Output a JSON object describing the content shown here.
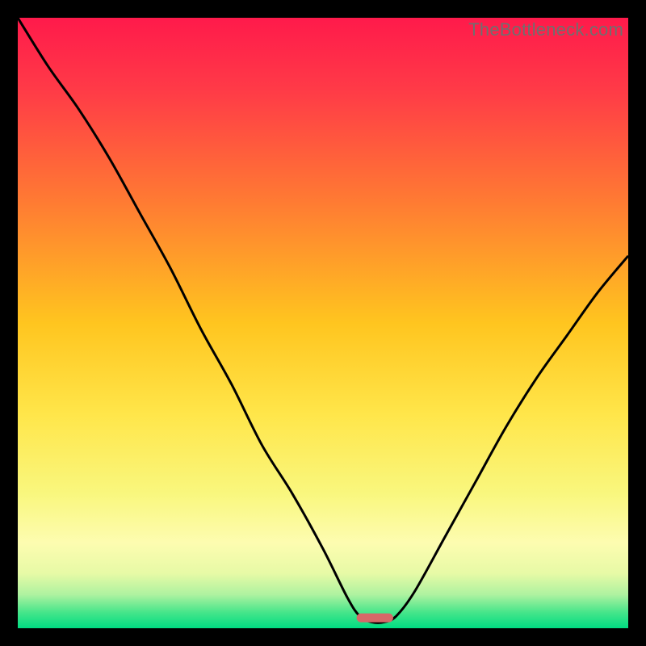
{
  "watermark": "TheBottleneck.com",
  "chart_data": {
    "type": "line",
    "title": "",
    "xlabel": "",
    "ylabel": "",
    "xlim": [
      0,
      100
    ],
    "ylim": [
      0,
      100
    ],
    "x": [
      0,
      5,
      10,
      15,
      20,
      25,
      30,
      35,
      40,
      45,
      50,
      54,
      56,
      58,
      60,
      62,
      65,
      70,
      75,
      80,
      85,
      90,
      95,
      100
    ],
    "values": [
      100,
      92,
      85,
      77,
      68,
      59,
      49,
      40,
      30,
      22,
      13,
      5,
      2,
      1,
      1,
      2,
      6,
      15,
      24,
      33,
      41,
      48,
      55,
      61
    ],
    "marker": {
      "x_start": 55.5,
      "x_end": 61.5,
      "y": 1.7,
      "color": "#d66868"
    },
    "gradient_stops": [
      {
        "offset": 0.0,
        "color": "#ff1a4b"
      },
      {
        "offset": 0.12,
        "color": "#ff3b47"
      },
      {
        "offset": 0.3,
        "color": "#ff7a33"
      },
      {
        "offset": 0.5,
        "color": "#ffc51f"
      },
      {
        "offset": 0.65,
        "color": "#ffe64a"
      },
      {
        "offset": 0.78,
        "color": "#f9f77e"
      },
      {
        "offset": 0.86,
        "color": "#fdfcb0"
      },
      {
        "offset": 0.91,
        "color": "#e7faa6"
      },
      {
        "offset": 0.945,
        "color": "#aef2a0"
      },
      {
        "offset": 0.975,
        "color": "#43e58a"
      },
      {
        "offset": 1.0,
        "color": "#00dc82"
      }
    ],
    "curve_color": "#000000",
    "curve_width": 3
  }
}
